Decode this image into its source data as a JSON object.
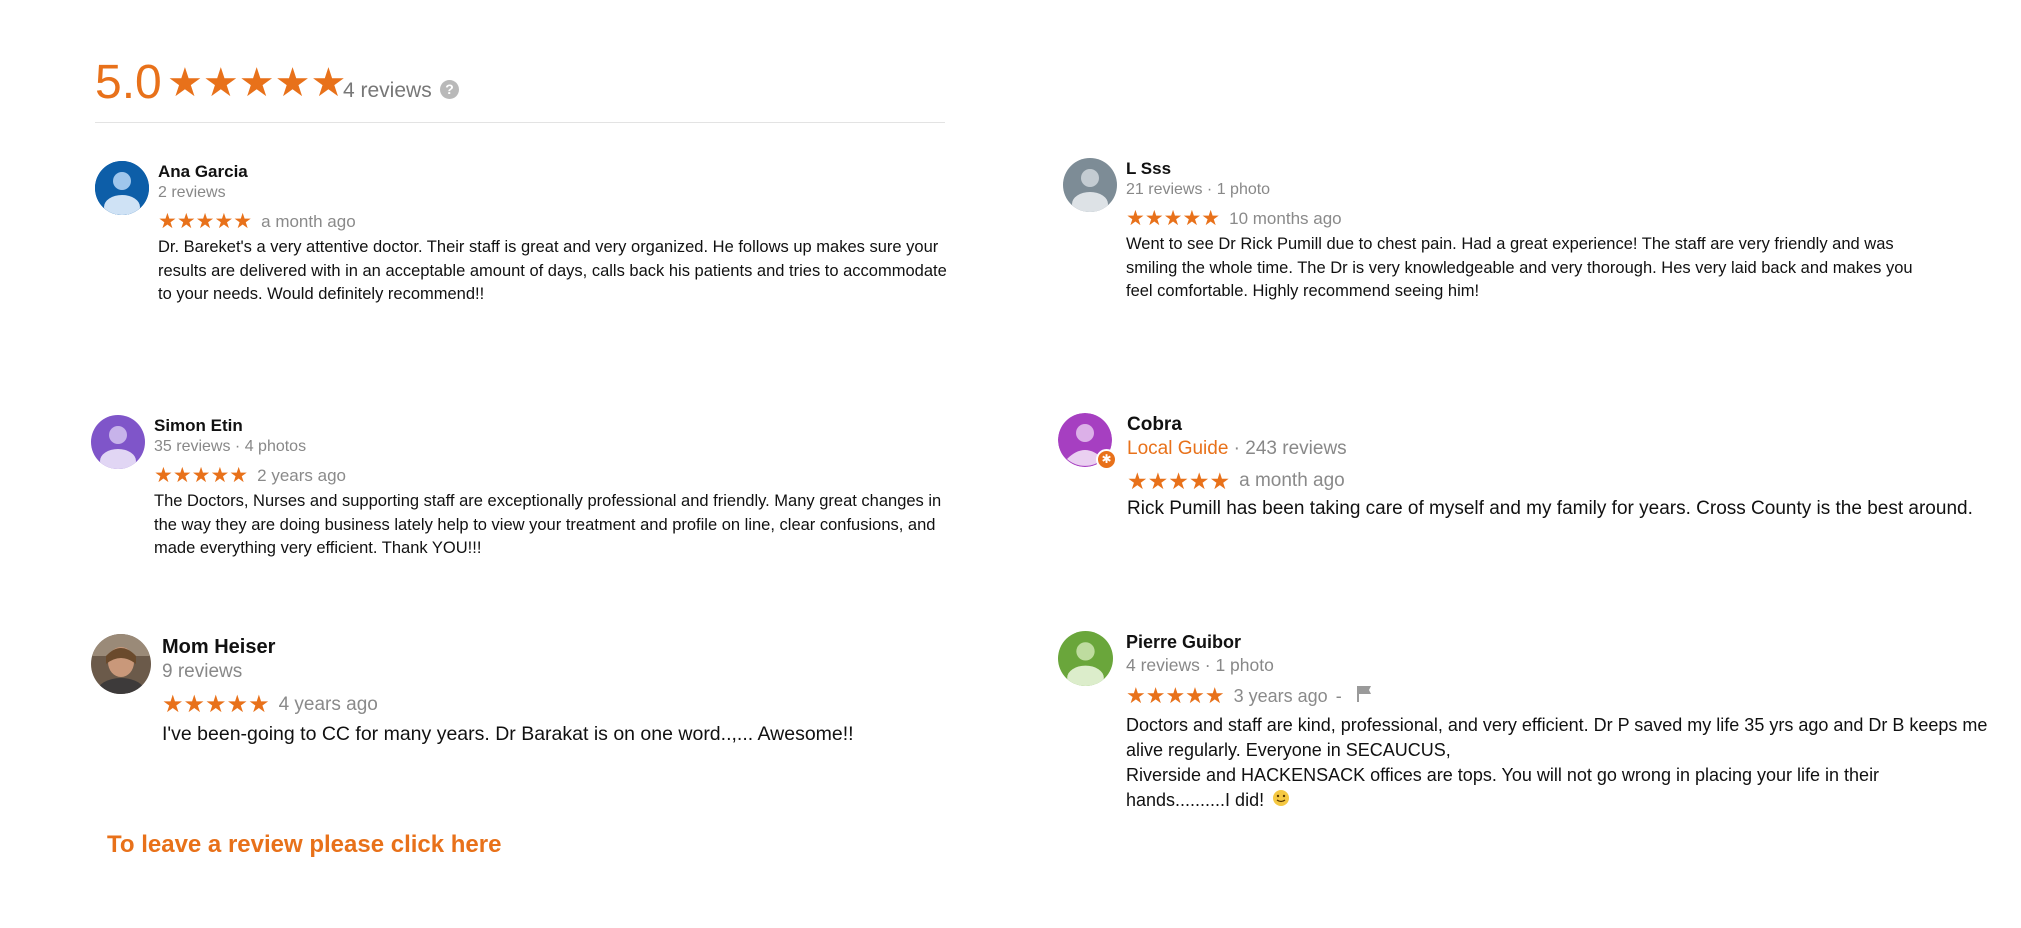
{
  "summary": {
    "score": "5.0",
    "stars": "★★★★★",
    "count": "4 reviews",
    "help": "?"
  },
  "reviews": [
    {
      "name": "Ana Garcia",
      "meta": "2 reviews",
      "stars": "★★★★★",
      "time": "a month ago",
      "text": "Dr. Bareket's a very attentive doctor. Their staff is great and very organized. He follows up makes sure your results are delivered with in an acceptable amount of days, calls back his patients and tries to accommodate to your needs. Would definitely recommend!!",
      "avatar_color": "#0d5ea8"
    },
    {
      "name": "L Sss",
      "meta": "21 reviews · 1 photo",
      "stars": "★★★★★",
      "time": "10 months ago",
      "text": "Went to see Dr Rick Pumill due to chest pain. Had a great experience! The staff are very friendly and was smiling the whole time. The Dr is very knowledgeable and very thorough. Hes very laid back and makes you feel comfortable. Highly recommend seeing him!",
      "avatar_color": "#7d8c96"
    },
    {
      "name": "Simon Etin",
      "meta": "35 reviews · 4 photos",
      "stars": "★★★★★",
      "time": "2 years ago",
      "text": "The Doctors, Nurses and supporting staff are exceptionally professional and friendly. Many great changes in the way they are doing business lately help to view your treatment and profile on line, clear confusions, and made everything very efficient. Thank YOU!!!",
      "avatar_color": "#7f55c9"
    },
    {
      "name": "Cobra",
      "guide": "Local Guide",
      "meta": " · 243 reviews",
      "stars": "★★★★★",
      "time": "a month ago",
      "text": "Rick Pumill has been taking care of myself and my family for years. Cross County is the best around.",
      "avatar_color": "#a63fc1",
      "badge": "✱"
    },
    {
      "name": "Mom Heiser",
      "meta": "9 reviews",
      "stars": "★★★★★",
      "time": "4 years ago",
      "text": "I've been-going to CC for many years. Dr Barakat is on one word..,... Awesome!!"
    },
    {
      "name": "Pierre Guibor",
      "meta": "4 reviews · 1 photo",
      "stars": "★★★★★",
      "time": "3 years ago",
      "time_suffix": "-",
      "text_line1": "Doctors and staff are kind, professional, and very efficient. Dr P saved my life 35 yrs ago and Dr B keeps me alive regularly. Everyone in SECAUCUS,",
      "text_line2": "Riverside and HACKENSACK offices are tops. You will not go wrong in placing your life in their hands..........I did!",
      "avatar_color": "#6aa63b"
    }
  ],
  "cta": "To leave a review please click here"
}
